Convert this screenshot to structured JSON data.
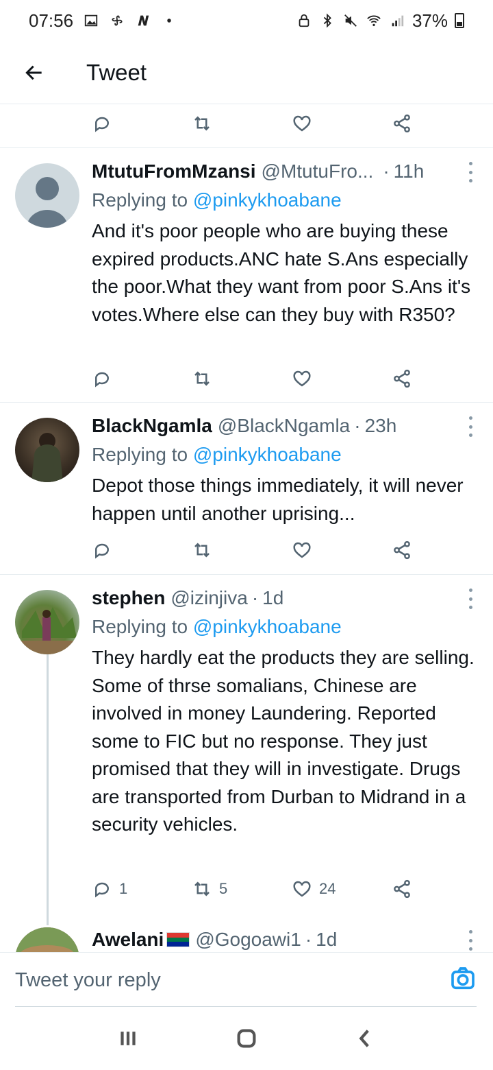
{
  "status_bar": {
    "time": "07:56",
    "battery": "37%",
    "left_icons": [
      "image-icon",
      "fan-icon",
      "n-icon",
      "dot-icon"
    ],
    "right_icons": [
      "lock-icon",
      "bluetooth-icon",
      "mute-icon",
      "wifi-icon",
      "signal-icon",
      "battery-icon"
    ]
  },
  "header": {
    "title": "Tweet",
    "back_icon": "arrow-left-icon"
  },
  "tweets": [
    {
      "name": "MtutuFromMzansi",
      "handle": "@MtutuFro...",
      "time": "11h",
      "replying_prefix": "Replying to",
      "replying_to": "@pinkykhoabane",
      "text": "And it's poor people who are buying these expired products.ANC hate S.Ans especially the poor.What they want from poor S.Ans it's votes.Where else can they buy with R350?",
      "replies": "",
      "retweets": "",
      "likes": ""
    },
    {
      "name": "BlackNgamla",
      "handle": "@BlackNgamla",
      "time": "23h",
      "replying_prefix": "Replying to",
      "replying_to": "@pinkykhoabane",
      "text": "Depot those things immediately, it will never happen until another uprising...",
      "replies": "",
      "retweets": "",
      "likes": ""
    },
    {
      "name": "stephen",
      "handle": "@izinjiva",
      "time": "1d",
      "replying_prefix": "Replying to",
      "replying_to": "@pinkykhoabane",
      "text": "They hardly eat the products they are selling. Some of thrse somalians, Chinese are involved in money Laundering. Reported some to FIC but no response. They just promised that they will in investigate. Drugs are transported from Durban to Midrand in a security vehicles.",
      "replies": "1",
      "retweets": "5",
      "likes": "24"
    },
    {
      "name": "Awelani",
      "handle": "@Gogoawi1",
      "time": "1d"
    }
  ],
  "composer": {
    "placeholder": "Tweet your reply",
    "camera_icon": "camera-icon"
  },
  "navbar": {
    "icons": [
      "recents-icon",
      "home-icon",
      "back-icon"
    ]
  },
  "separator": "·"
}
